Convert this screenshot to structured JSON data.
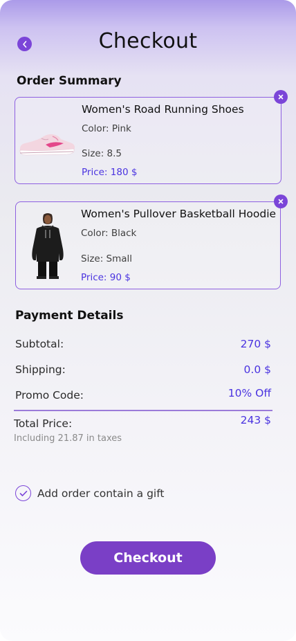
{
  "header": {
    "title": "Checkout"
  },
  "order_summary": {
    "title": "Order Summary",
    "items": [
      {
        "name": "Women's Road Running Shoes",
        "color": "Color: Pink",
        "size": "Size: 8.5",
        "price": "Price: 180 $",
        "image_icon": "pink-running-shoe"
      },
      {
        "name": "Women's Pullover Basketball Hoodie",
        "color": "Color: Black",
        "size": "Size: Small",
        "price": "Price: 90 $",
        "image_icon": "black-hoodie-model"
      }
    ]
  },
  "payment": {
    "title": "Payment Details",
    "subtotal_label": "Subtotal:",
    "subtotal_value": "270 $",
    "shipping_label": "Shipping:",
    "shipping_value": "0.0 $",
    "promo_label": "Promo Code:",
    "promo_value": "10% Off",
    "total_label": "Total Price:",
    "total_value": "243 $",
    "tax_note": "Including 21.87 in taxes"
  },
  "gift": {
    "label": "Add order contain a gift",
    "checked": true
  },
  "checkout_button": {
    "label": "Checkout"
  },
  "colors": {
    "accent": "#7b45d8",
    "price_blue": "#4a33e0",
    "button": "#7a3fc6"
  }
}
